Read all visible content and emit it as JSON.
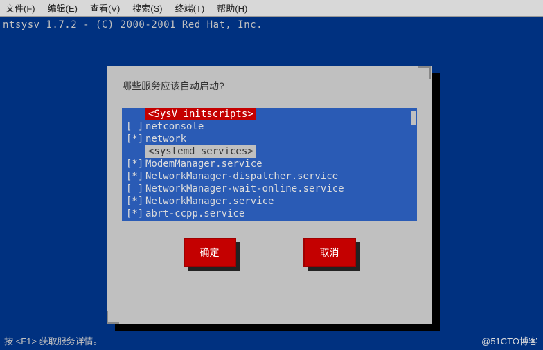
{
  "menubar": {
    "file": "文件(F)",
    "edit": "编辑(E)",
    "view": "查看(V)",
    "search": "搜索(S)",
    "terminal": "终端(T)",
    "help": "帮助(H)"
  },
  "title": "ntsysv 1.7.2 - (C) 2000-2001 Red Hat, Inc.",
  "dialog": {
    "title": "哪些服务应该自动启动?",
    "section1": "<SysV initscripts>",
    "section2": "<systemd services>",
    "items": [
      {
        "mark": "[ ]",
        "label": "netconsole"
      },
      {
        "mark": "[*]",
        "label": "network"
      }
    ],
    "items2": [
      {
        "mark": "[*]",
        "label": "ModemManager.service"
      },
      {
        "mark": "[*]",
        "label": "NetworkManager-dispatcher.service"
      },
      {
        "mark": "[ ]",
        "label": "NetworkManager-wait-online.service"
      },
      {
        "mark": "[*]",
        "label": "NetworkManager.service"
      },
      {
        "mark": "[*]",
        "label": "abrt-ccpp.service"
      }
    ],
    "ok": "确定",
    "cancel": "取消"
  },
  "helpline": "按 <F1> 获取服务详情。",
  "watermark": "@51CTO博客"
}
